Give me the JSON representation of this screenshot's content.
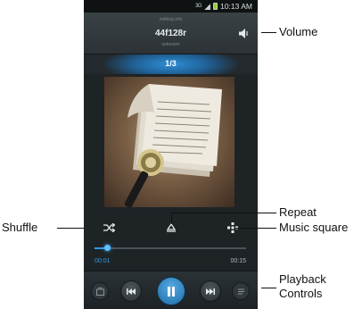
{
  "status_bar": {
    "network": "3G",
    "time": "10:13 AM"
  },
  "player": {
    "track_title": "44f128r",
    "artist_line": "unknown",
    "top_line": "nothing info",
    "counter": "1/3",
    "elapsed": "00:01",
    "total": "00:15",
    "progress_fraction": 0.08
  },
  "callouts": {
    "volume": "Volume",
    "repeat": "Repeat",
    "music_square": "Music square",
    "shuffle": "Shuffle",
    "playback_line1": "Playback",
    "playback_line2": "Controls"
  },
  "icons": {
    "volume": "speaker-icon",
    "shuffle": "shuffle-icon",
    "repeat": "repeat-icon",
    "music_square": "music-square-icon",
    "previous": "rewind-icon",
    "play_pause": "pause-icon",
    "next": "fast-forward-icon"
  },
  "colors": {
    "accent": "#2f9be6",
    "background": "#1e2326"
  }
}
